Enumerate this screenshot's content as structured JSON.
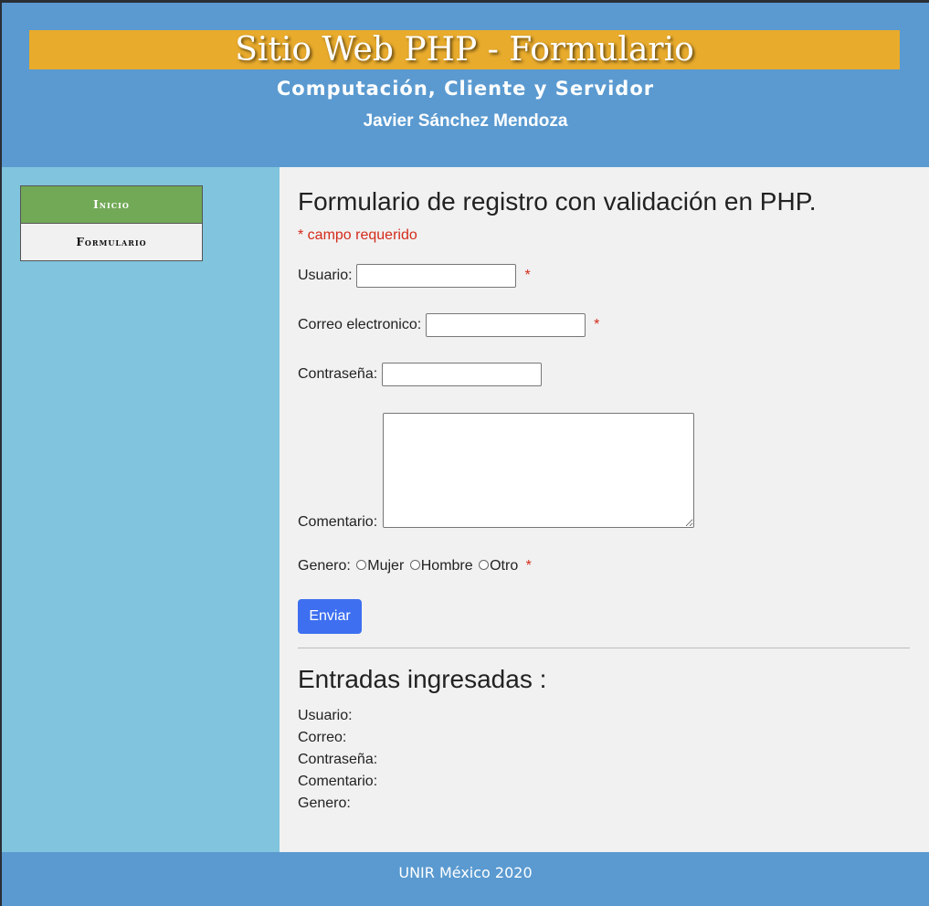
{
  "header": {
    "title": "Sitio Web PHP - Formulario",
    "subtitle": "Computación, Cliente y Servidor",
    "author": "Javier Sánchez Mendoza"
  },
  "sidebar": {
    "items": [
      {
        "label": "Inicio",
        "active": true
      },
      {
        "label": "Formulario",
        "active": false
      }
    ]
  },
  "form": {
    "title": "Formulario de registro con validación en PHP.",
    "required_note": "* campo requerido",
    "required_mark": "*",
    "usuario_label": "Usuario:",
    "usuario_value": "",
    "correo_label": "Correo electronico:",
    "correo_value": "",
    "contrasena_label": "Contraseña:",
    "contrasena_value": "",
    "comentario_label": "Comentario:",
    "comentario_value": "",
    "genero_label": "Genero:",
    "genero_options": [
      "Mujer",
      "Hombre",
      "Otro"
    ],
    "submit_label": "Enviar"
  },
  "entries": {
    "title": "Entradas ingresadas :",
    "usuario": "Usuario:",
    "correo": "Correo:",
    "contrasena": "Contraseña:",
    "comentario": "Comentario:",
    "genero": "Genero:"
  },
  "footer": {
    "text": "UNIR México 2020"
  },
  "colors": {
    "header_bg": "#5a9ad0",
    "title_bar": "#e8ab2c",
    "sidebar_bg": "#80c4de",
    "nav_active": "#72a957",
    "button": "#3d6ff0",
    "required": "#d42b1a"
  }
}
